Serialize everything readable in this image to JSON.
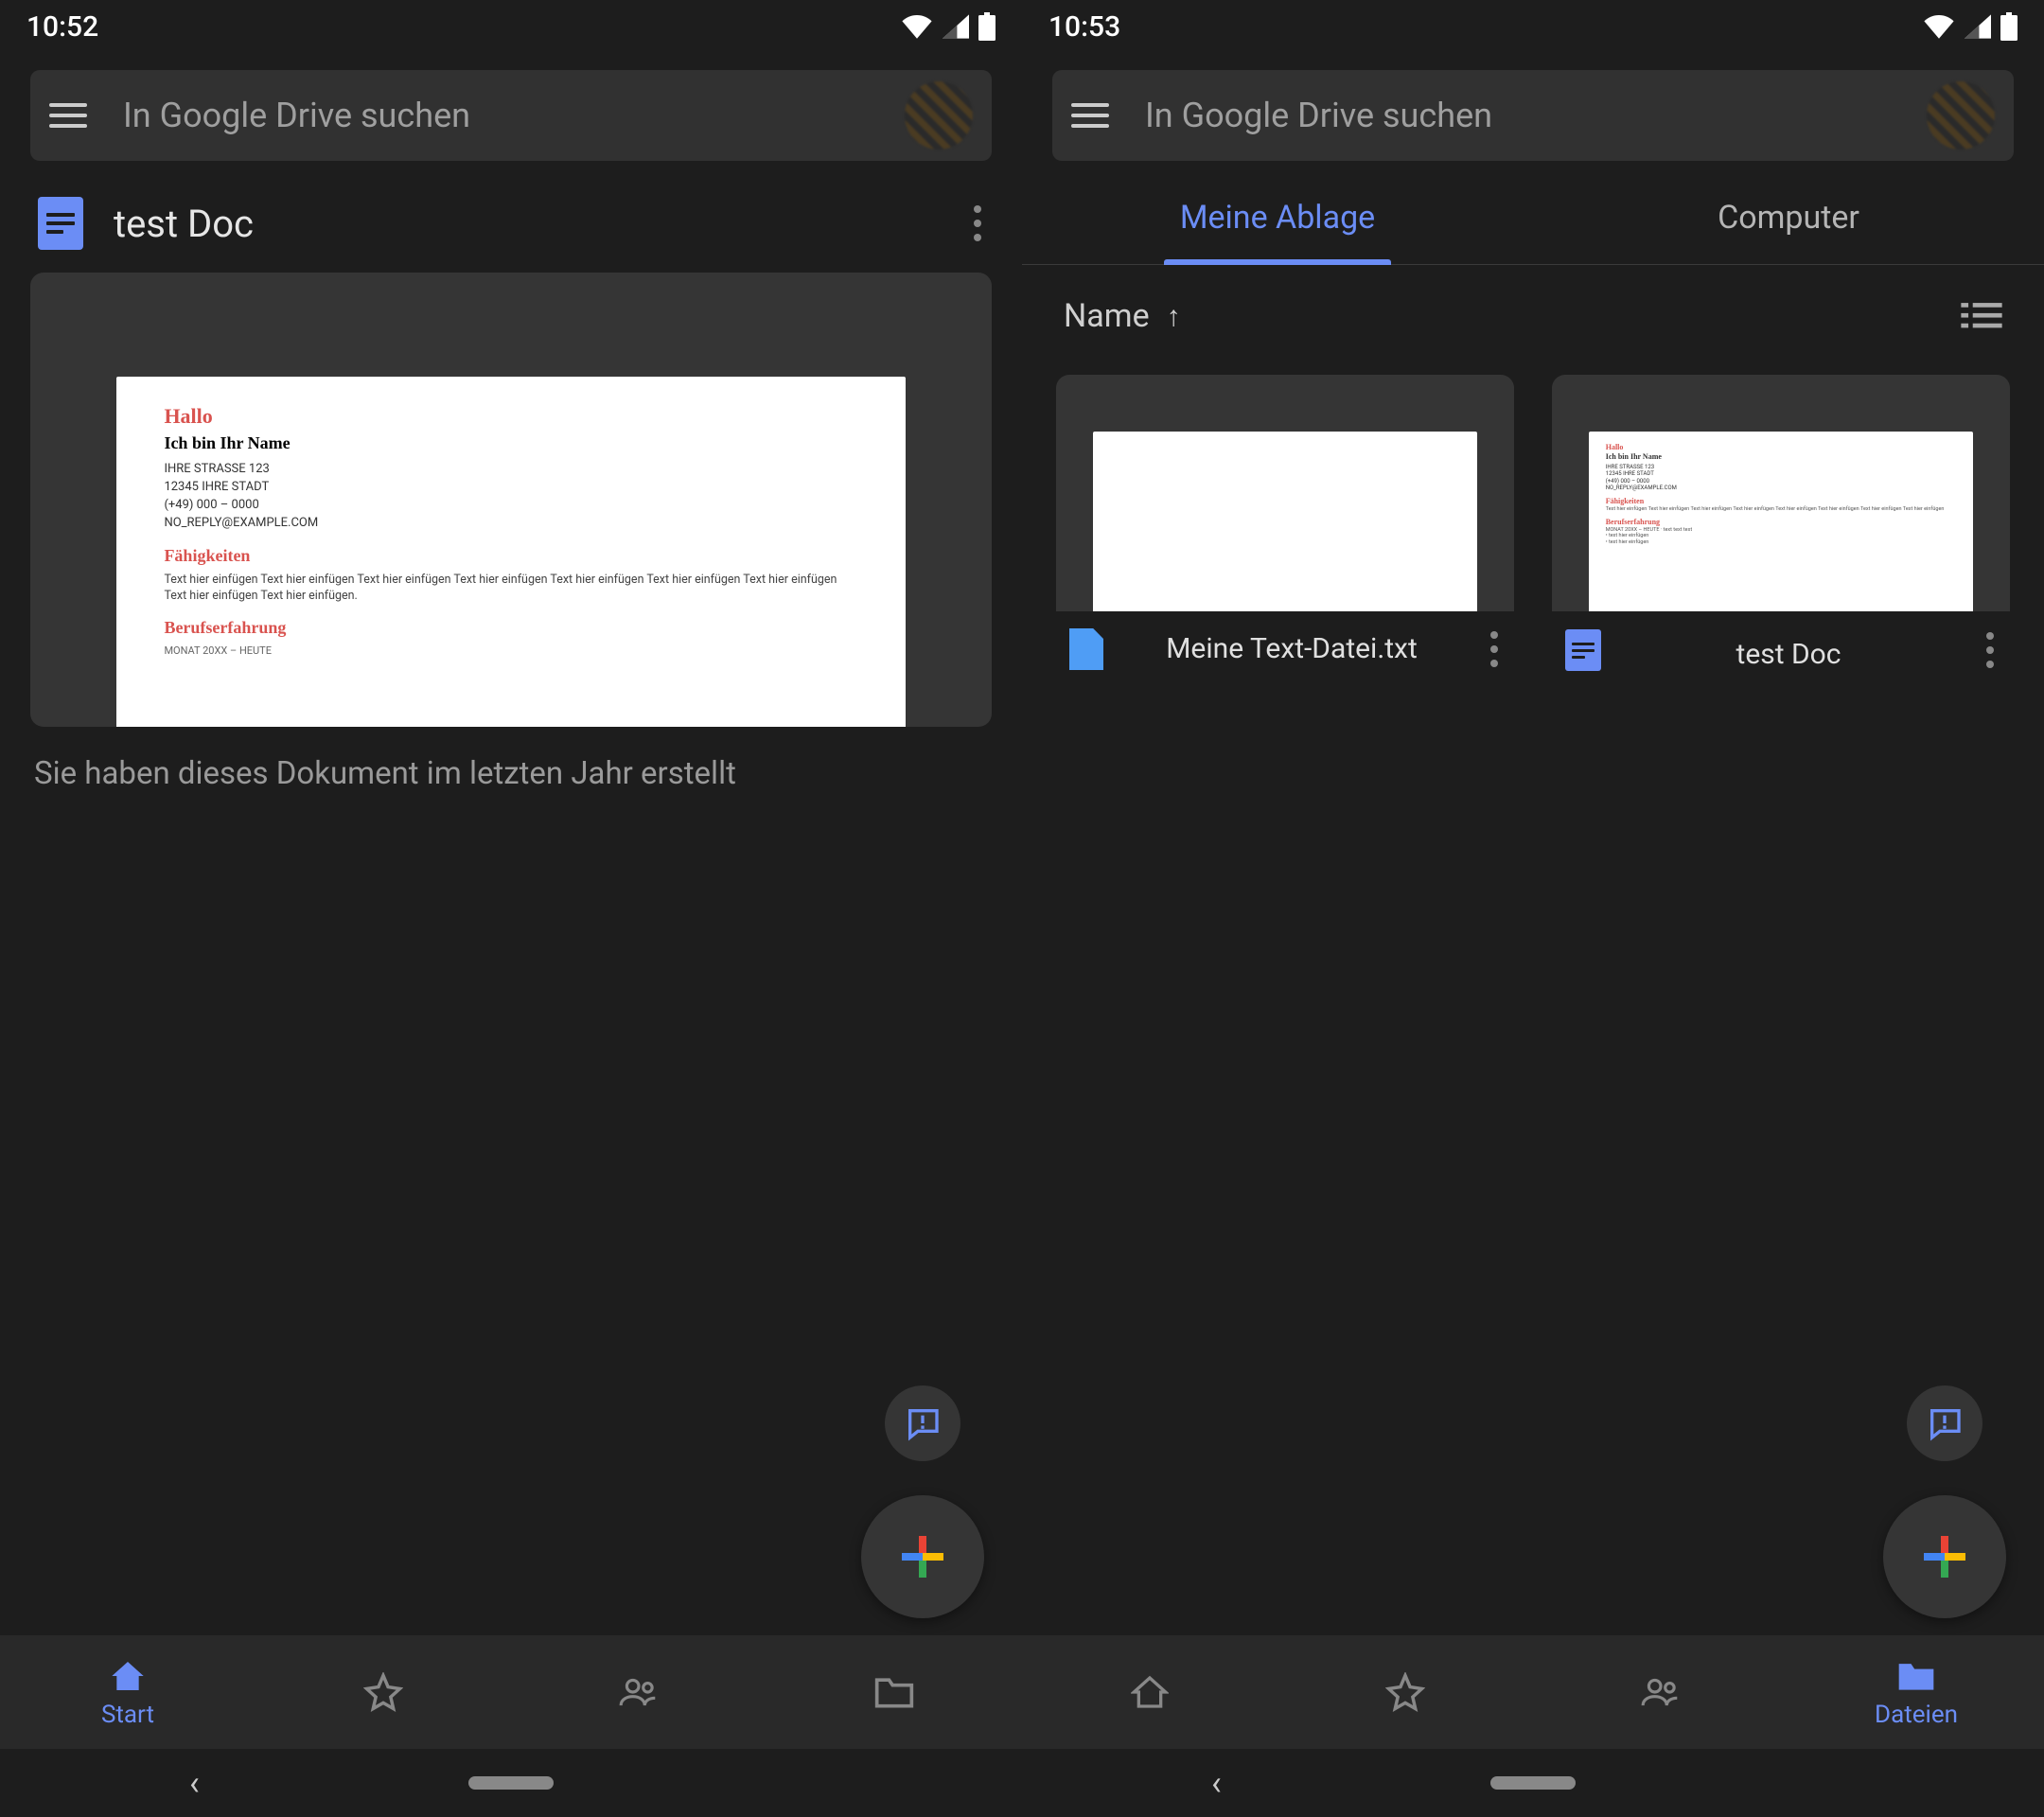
{
  "left": {
    "status_time": "10:52",
    "search_placeholder": "In Google Drive suchen",
    "file_title": "test Doc",
    "preview": {
      "hello": "Hallo",
      "name_line": "Ich bin Ihr Name",
      "addr1": "IHRE STRASSE 123",
      "addr2": "12345 IHRE STADT",
      "phone": "(+49) 000 – 0000",
      "email": "NO_REPLY@EXAMPLE.COM",
      "sec1": "Fähigkeiten",
      "body1": "Text hier einfügen Text hier einfügen Text hier einfügen Text hier einfügen Text hier einfügen Text hier einfügen Text hier einfügen Text hier einfügen Text hier einfügen.",
      "sec2": "Berufserfahrung",
      "date": "MONAT 20XX – HEUTE"
    },
    "subtitle": "Sie haben dieses Dokument im letzten Jahr erstellt",
    "nav": {
      "start": "Start",
      "starred": "",
      "shared": "",
      "files": ""
    }
  },
  "right": {
    "status_time": "10:53",
    "search_placeholder": "In Google Drive suchen",
    "tabs": {
      "drive": "Meine Ablage",
      "computer": "Computer"
    },
    "sort_label": "Name",
    "items": [
      {
        "name": "Meine Text-Datei.txt"
      },
      {
        "name": "test Doc"
      }
    ],
    "nav": {
      "files": "Dateien"
    }
  }
}
